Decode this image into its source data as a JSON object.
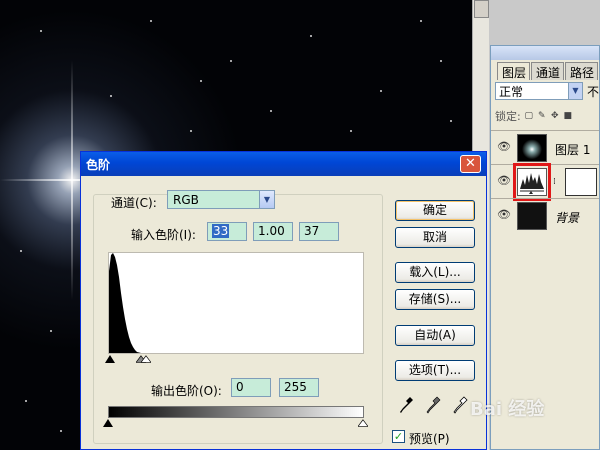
{
  "layers_panel": {
    "tabs": [
      "图层",
      "通道",
      "路径"
    ],
    "blend_mode": "正常",
    "opacity_label": "不",
    "lock_label": "锁定:",
    "layers": [
      {
        "name": "图层 1",
        "visible": true
      },
      {
        "name": "",
        "visible": true,
        "type": "levels-adjustment",
        "selected_highlight": true
      },
      {
        "name": "背景",
        "visible": true
      }
    ]
  },
  "dialog": {
    "title": "色阶",
    "channel_label": "通道(C):",
    "channel_value": "RGB",
    "input_levels_label": "输入色阶(I):",
    "input_levels": [
      "33",
      "1.00",
      "37"
    ],
    "output_levels_label": "输出色阶(O):",
    "output_levels": [
      "0",
      "255"
    ],
    "buttons": {
      "ok": "确定",
      "cancel": "取消",
      "load": "载入(L)...",
      "save": "存储(S)...",
      "auto": "自动(A)",
      "options": "选项(T)..."
    },
    "preview_label": "预览(P)",
    "preview_checked": true,
    "close_glyph": "✕"
  },
  "watermark": "Bai 经验",
  "colors": {
    "title_bar": "#0046d5",
    "field_bg": "#c7ecd9",
    "dialog_bg": "#ece9d8",
    "highlight_red": "#e01818"
  }
}
